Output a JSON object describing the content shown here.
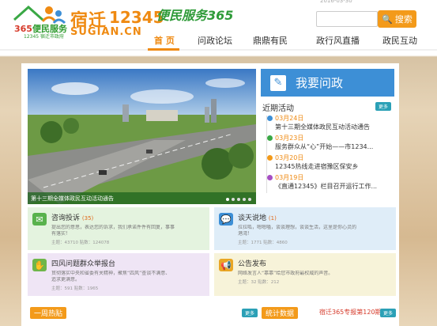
{
  "header": {
    "top_meta": "2016-03-30",
    "logo_365": "365",
    "logo_365_suffix": "便民服务",
    "logo_sub": "12345 宿迁市政府",
    "brand_cn": "宿迁",
    "brand_num": "12345",
    "brand_en": "SUGIAN.CN",
    "slogan": "便民服务365",
    "search_placeholder": "",
    "search_label": "搜索"
  },
  "nav": [
    {
      "label": "首 页",
      "active": true
    },
    {
      "label": "问政论坛",
      "active": false
    },
    {
      "label": "鼎鼎有民",
      "active": false
    },
    {
      "label": "政行风直播",
      "active": false
    },
    {
      "label": "政民互动",
      "active": false
    }
  ],
  "banner": {
    "caption": "第十三期全媒体政民互动活动通告"
  },
  "ask": {
    "label": "我要问政"
  },
  "recent": {
    "title": "近期活动",
    "more": "更多",
    "items": [
      {
        "date": "03月24日",
        "text": "第十三期全媒体政民互动活动通告",
        "color": "#3d8fd6"
      },
      {
        "date": "03月23日",
        "text": "服务群众从“心”开始——市1234...",
        "color": "#3aa845"
      },
      {
        "date": "03月20日",
        "text": "12345热线走进宿豫区保安乡",
        "color": "#f39a1a"
      },
      {
        "date": "03月19日",
        "text": "《直通12345》栏目召开运行工作...",
        "color": "#a64fc4"
      }
    ]
  },
  "cards": [
    {
      "title": "咨询投诉",
      "count": "(35)",
      "desc1": "提出您的意思，表达您的诉求，我们承诺件件有回复，事事",
      "desc2": "有落实！",
      "meta": "主题：43710 贴数：124078",
      "bg": "#e4f3df",
      "icon_color": "#59b24d",
      "icon": "chat-icon"
    },
    {
      "title": "谈天说地",
      "count": "(1)",
      "desc1": "拉拉呱，嗯嗯嗑，谈谈理想，谈谈生活，这里是你心灵的",
      "desc2": "港湾！",
      "meta": "主题：1771 贴数：4860",
      "bg": "#dfedf8",
      "icon_color": "#3d8fd6",
      "icon": "chat-bubbles-icon"
    },
    {
      "title": "四风问题群众举报台",
      "count": "",
      "desc1": "贯彻落实中央和省委有关精神，聚焦“四风”查谈不满意、",
      "desc2": "追求更满意。",
      "meta": "主题：591 贴数：1965",
      "bg": "#efe5f5",
      "icon_color": "#6fb64a",
      "icon": "hand-icon"
    },
    {
      "title": "公告发布",
      "count": "",
      "desc1": "网络发言人“靠靠”给您市政府最权威的声音。",
      "desc2": "",
      "meta": "主题：32 贴数：212",
      "bg": "#f7f3d9",
      "icon_color": "#e9a624",
      "icon": "speaker-icon"
    }
  ],
  "bottom": {
    "hot_title": "一周热贴",
    "stats_title": "统计数据",
    "issue_text": "宿迁365专报第120期",
    "more": "更多"
  }
}
